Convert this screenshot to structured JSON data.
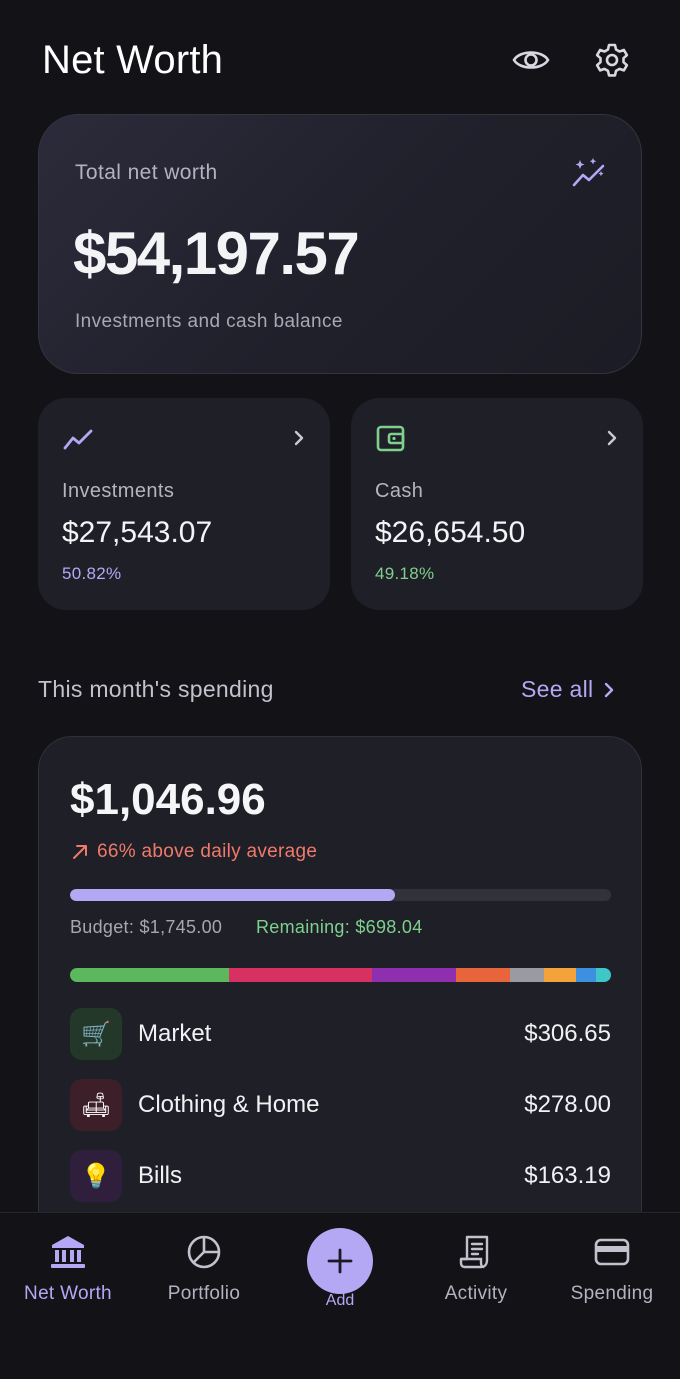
{
  "header": {
    "title": "Net Worth",
    "icons": [
      "eye-icon",
      "gear-icon"
    ]
  },
  "hero": {
    "label": "Total net worth",
    "value": "$54,197.57",
    "subtitle": "Investments and cash balance",
    "icon": "sparkle-chart-icon"
  },
  "accounts": [
    {
      "label": "Investments",
      "value": "$27,543.07",
      "percent": "50.82%",
      "icon": "trend-line-icon",
      "accent": "#b4a8f5"
    },
    {
      "label": "Cash",
      "value": "$26,654.50",
      "percent": "49.18%",
      "icon": "wallet-icon",
      "accent": "#7ed08c"
    }
  ],
  "spending": {
    "section_title": "This month's spending",
    "see_all": "See all",
    "total": "$1,046.96",
    "delta_text": "66% above daily average",
    "delta_color": "#f07a6a",
    "budget_label": "Budget: $1,745.00",
    "remaining_label": "Remaining: $698.04",
    "budget_used_fraction": 0.6,
    "category_segments": [
      {
        "color": "#5cb85c",
        "fraction": 0.293
      },
      {
        "color": "#d63160",
        "fraction": 0.265
      },
      {
        "color": "#8e2fb0",
        "fraction": 0.156
      },
      {
        "color": "#e8643a",
        "fraction": 0.1
      },
      {
        "color": "#9a9aa0",
        "fraction": 0.063
      },
      {
        "color": "#f3a33a",
        "fraction": 0.058
      },
      {
        "color": "#3d8fe0",
        "fraction": 0.038
      },
      {
        "color": "#3fc6c6",
        "fraction": 0.027
      }
    ],
    "categories": [
      {
        "name": "Market",
        "amount": "$306.65",
        "icon": "cart-icon",
        "glyph": "🛒",
        "bg": "#24382a"
      },
      {
        "name": "Clothing & Home",
        "amount": "$278.00",
        "icon": "sofa-icon",
        "glyph": "🛋",
        "bg": "#3d1f2a"
      },
      {
        "name": "Bills",
        "amount": "$163.19",
        "icon": "lightbulb-icon",
        "glyph": "💡",
        "bg": "#2f1f3d"
      }
    ]
  },
  "nav": {
    "items": [
      {
        "label": "Net Worth",
        "icon": "bank-icon",
        "active": true
      },
      {
        "label": "Portfolio",
        "icon": "pie-chart-icon",
        "active": false
      },
      {
        "label": "Activity",
        "icon": "receipt-icon",
        "active": false
      },
      {
        "label": "Spending",
        "icon": "card-icon",
        "active": false
      }
    ],
    "add_label": "Add",
    "accent": "#b4a8f5"
  }
}
